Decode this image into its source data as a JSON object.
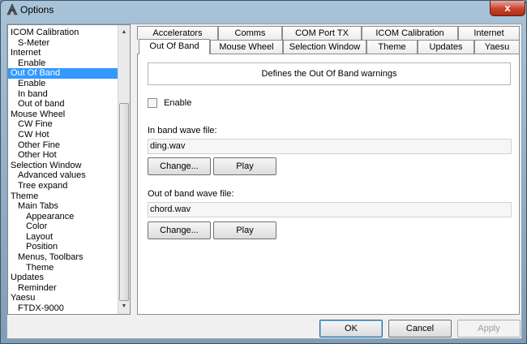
{
  "window": {
    "title": "Options",
    "close_glyph": "x"
  },
  "tree": {
    "items": [
      {
        "label": "ICOM Calibration",
        "level": 0
      },
      {
        "label": "S-Meter",
        "level": 1
      },
      {
        "label": "Internet",
        "level": 0
      },
      {
        "label": "Enable",
        "level": 1
      },
      {
        "label": "Out Of Band",
        "level": 0,
        "selected": true
      },
      {
        "label": "Enable",
        "level": 1
      },
      {
        "label": "In band",
        "level": 1
      },
      {
        "label": "Out of band",
        "level": 1
      },
      {
        "label": "Mouse Wheel",
        "level": 0
      },
      {
        "label": "CW Fine",
        "level": 1
      },
      {
        "label": "CW Hot",
        "level": 1
      },
      {
        "label": "Other Fine",
        "level": 1
      },
      {
        "label": "Other Hot",
        "level": 1
      },
      {
        "label": "Selection Window",
        "level": 0
      },
      {
        "label": "Advanced values",
        "level": 1
      },
      {
        "label": "Tree expand",
        "level": 1
      },
      {
        "label": "Theme",
        "level": 0
      },
      {
        "label": "Main Tabs",
        "level": 1
      },
      {
        "label": "Appearance",
        "level": 2
      },
      {
        "label": "Color",
        "level": 2
      },
      {
        "label": "Layout",
        "level": 2
      },
      {
        "label": "Position",
        "level": 2
      },
      {
        "label": "Menus, Toolbars",
        "level": 1
      },
      {
        "label": "Theme",
        "level": 2
      },
      {
        "label": "Updates",
        "level": 0
      },
      {
        "label": "Reminder",
        "level": 1
      },
      {
        "label": "Yaesu",
        "level": 0
      },
      {
        "label": "FTDX-9000",
        "level": 1
      }
    ]
  },
  "tabs": {
    "row1": [
      "Accelerators",
      "Comms",
      "COM Port TX",
      "ICOM Calibration",
      "Internet"
    ],
    "row2": [
      "Out Of Band",
      "Mouse Wheel",
      "Selection Window",
      "Theme",
      "Updates",
      "Yaesu"
    ],
    "active": "Out Of Band"
  },
  "panel": {
    "description": "Defines the Out Of Band warnings",
    "enable_label": "Enable",
    "enable_checked": false,
    "in_band_label": "In band wave file:",
    "in_band_value": "ding.wav",
    "out_band_label": "Out of band wave file:",
    "out_band_value": "chord.wav",
    "change_label": "Change...",
    "play_label": "Play"
  },
  "footer": {
    "ok": "OK",
    "cancel": "Cancel",
    "apply": "Apply"
  }
}
